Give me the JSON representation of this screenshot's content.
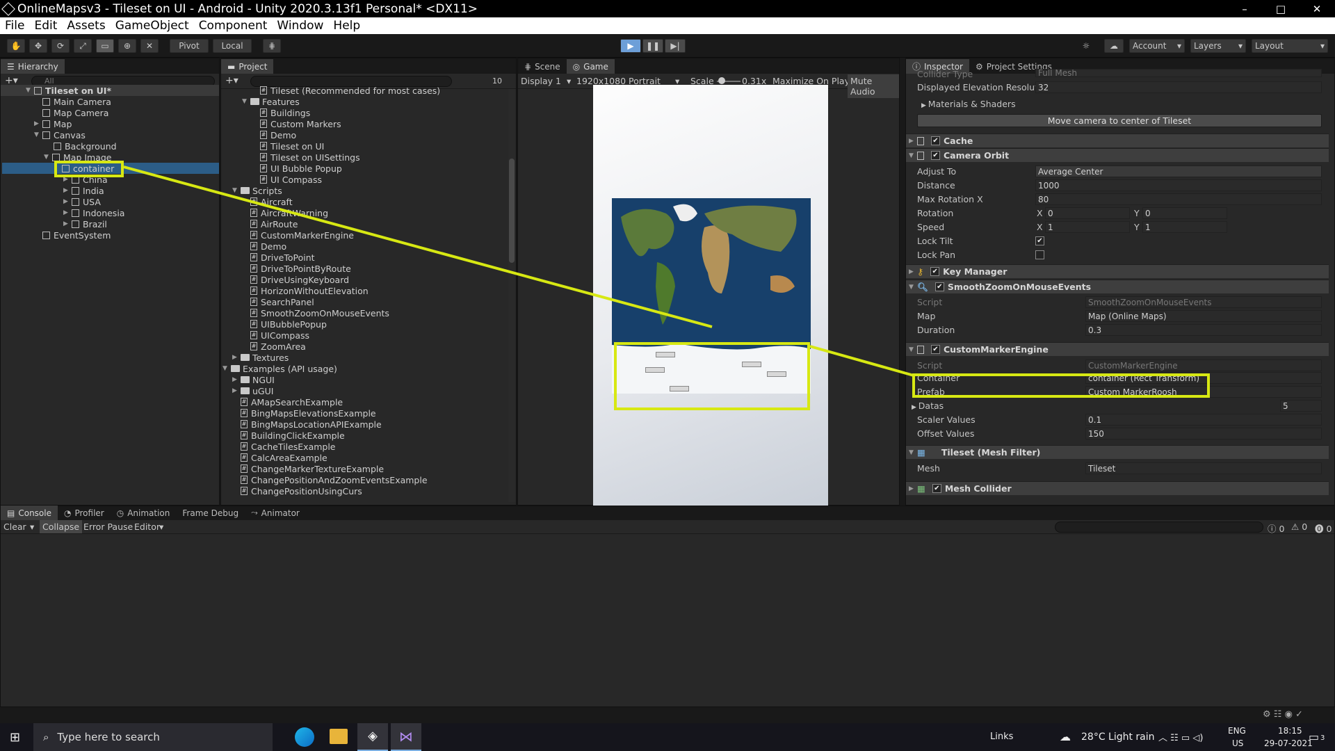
{
  "window": {
    "title": "OnlineMapsv3 - Tileset on UI - Android - Unity 2020.3.13f1 Personal* <DX11>",
    "minimize": "–",
    "maximize": "□",
    "close": "✕"
  },
  "menu": [
    "File",
    "Edit",
    "Assets",
    "GameObject",
    "Component",
    "Window",
    "Help"
  ],
  "toolbar": {
    "pivot": "Pivot",
    "local": "Local",
    "account": "Account",
    "layers": "Layers",
    "layout": "Layout"
  },
  "hierarchy": {
    "tab": "Hierarchy",
    "search_placeholder": "All",
    "items": [
      "Tileset on UI*",
      "Main Camera",
      "Map Camera",
      "Map",
      "Canvas",
      "Background",
      "Map Image",
      "container",
      "China",
      "India",
      "USA",
      "Indonesia",
      "Brazil",
      "EventSystem"
    ]
  },
  "project": {
    "tab": "Project",
    "badge": "10",
    "items": [
      "Tileset (Recommended for most cases)",
      "Features",
      "Buildings",
      "Custom Markers",
      "Demo",
      "Tileset on UI",
      "Tileset on UISettings",
      "UI Bubble Popup",
      "UI Compass",
      "Scripts",
      "Aircraft",
      "AircraftWarning",
      "AirRoute",
      "CustomMarkerEngine",
      "Demo",
      "DriveToPoint",
      "DriveToPointByRoute",
      "DriveUsingKeyboard",
      "HorizonWithoutElevation",
      "SearchPanel",
      "SmoothZoomOnMouseEvents",
      "UIBubblePopup",
      "UICompass",
      "ZoomArea",
      "Textures",
      "Examples (API usage)",
      "NGUI",
      "uGUI",
      "AMapSearchExample",
      "BingMapsElevationsExample",
      "BingMapsLocationAPIExample",
      "BuildingClickExample",
      "CacheTilesExample",
      "CalcAreaExample",
      "ChangeMarkerTextureExample",
      "ChangePositionAndZoomEventsExample",
      "ChangePositionUsingCurs"
    ]
  },
  "game": {
    "tab_scene": "Scene",
    "tab_game": "Game",
    "display": "Display 1",
    "resolution": "1920x1080 Portrait",
    "scale_label": "Scale",
    "scale_value": "0.31x",
    "maximize": "Maximize On Play",
    "mute": "Mute Audio"
  },
  "inspector": {
    "tab": "Inspector",
    "tab2": "Project Settings",
    "collider_type_label": "Collider Type",
    "collider_type": "Full Mesh",
    "elev_label": "Displayed Elevation Resolution",
    "elev_value": "32",
    "materials": "Materials & Shaders",
    "move_camera": "Move camera to center of Tileset",
    "cache": "Cache",
    "camera_orbit": "Camera Orbit",
    "adjust_label": "Adjust To",
    "adjust_value": "Average Center",
    "distance_label": "Distance",
    "distance_value": "1000",
    "maxrot_label": "Max Rotation X",
    "maxrot_value": "80",
    "rotation_label": "Rotation",
    "rot_x": "0",
    "rot_y": "0",
    "speed_label": "Speed",
    "speed_x": "1",
    "speed_y": "1",
    "x": "X",
    "y": "Y",
    "locktilt_label": "Lock Tilt",
    "lockpan_label": "Lock Pan",
    "keymanager": "Key Manager",
    "smoothzoom": "SmoothZoomOnMouseEvents",
    "script_label": "Script",
    "script_value": "SmoothZoomOnMouseEvents",
    "map_label": "Map",
    "map_value": "Map (Online Maps)",
    "duration_label": "Duration",
    "duration_value": "0.3",
    "cme": "CustomMarkerEngine",
    "cme_script_label": "Script",
    "cme_script_value": "CustomMarkerEngine",
    "container_label": "Container",
    "container_value": "container (Rect Transform)",
    "prefab_label": "Prefab",
    "prefab_value": "Custom MarkerRoosh",
    "datas_label": "Datas",
    "datas_value": "5",
    "scaler_label": "Scaler Values",
    "scaler_value": "0.1",
    "offset_label": "Offset Values",
    "offset_value": "150",
    "meshfilter": "Tileset (Mesh Filter)",
    "mesh_label": "Mesh",
    "mesh_value": "Tileset",
    "meshcollider": "Mesh Collider"
  },
  "console": {
    "tabs": [
      "Console",
      "Profiler",
      "Animation",
      "Frame Debug",
      "Animator"
    ],
    "clear": "Clear",
    "collapse": "Collapse",
    "error_pause": "Error Pause",
    "editor": "Editor",
    "count_log": "0",
    "count_warn": "0",
    "count_err": "0"
  },
  "taskbar": {
    "search": "Type here to search",
    "links": "Links",
    "weather": "28°C  Light rain",
    "lang1": "ENG",
    "lang2": "US",
    "time": "18:15",
    "date": "29-07-2021",
    "notif": "3"
  },
  "colors": {
    "highlight": "#d7e813",
    "accent": "#6d9fd8"
  }
}
